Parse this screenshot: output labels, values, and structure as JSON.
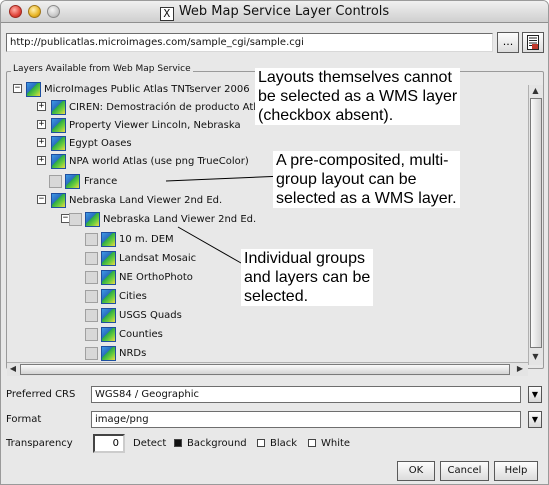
{
  "window": {
    "title": "Web Map Service Layer Controls",
    "x_logo": "X"
  },
  "url": {
    "value": "http://publicatlas.microimages.com/sample_cgi/sample.cgi",
    "browse_label": "..."
  },
  "layers": {
    "legend": "Layers Available from Web Map Service",
    "rows": [
      {
        "label": "MicroImages Public Atlas TNTserver 2006",
        "toggle": "−",
        "checkbox": false
      },
      {
        "label": "CIREN: Demostración de producto Atl",
        "toggle": "+",
        "checkbox": false
      },
      {
        "label": "Property Viewer Lincoln, Nebraska",
        "toggle": "+",
        "checkbox": false
      },
      {
        "label": "Egypt Oases",
        "toggle": "+",
        "checkbox": false
      },
      {
        "label": "NPA world Atlas (use png TrueColor)",
        "toggle": "+",
        "checkbox": false
      },
      {
        "label": "France",
        "toggle": "",
        "checkbox": true
      },
      {
        "label": "Nebraska Land Viewer 2nd Ed.",
        "toggle": "−",
        "checkbox": false
      },
      {
        "label": "Nebraska Land Viewer 2nd Ed.",
        "toggle": "−",
        "checkbox": true
      },
      {
        "label": "10 m. DEM",
        "toggle": "",
        "checkbox": true
      },
      {
        "label": "Landsat Mosaic",
        "toggle": "",
        "checkbox": true
      },
      {
        "label": "NE OrthoPhoto",
        "toggle": "",
        "checkbox": true
      },
      {
        "label": "Cities",
        "toggle": "",
        "checkbox": true
      },
      {
        "label": "USGS Quads",
        "toggle": "",
        "checkbox": true
      },
      {
        "label": "Counties",
        "toggle": "",
        "checkbox": true
      },
      {
        "label": "NRDs",
        "toggle": "",
        "checkbox": true
      }
    ]
  },
  "callouts": {
    "c1": "Layouts themselves cannot\nbe selected as a WMS layer\n(checkbox absent).",
    "c2": "A pre-composited, multi-\ngroup layout can be\nselected as a WMS layer.",
    "c3": "Individual groups\nand layers can be\nselected."
  },
  "crs": {
    "label": "Preferred CRS",
    "value": "WGS84 / Geographic"
  },
  "format": {
    "label": "Format",
    "value": "image/png"
  },
  "transparency": {
    "label": "Transparency",
    "value": "0",
    "detect_label": "Detect",
    "options": [
      {
        "label": "Background",
        "checked": true
      },
      {
        "label": "Black",
        "checked": false
      },
      {
        "label": "White",
        "checked": false
      }
    ]
  },
  "buttons": {
    "ok": "OK",
    "cancel": "Cancel",
    "help": "Help"
  },
  "icons": {
    "row_icon": "map-layer-icon",
    "doc_button": "document-icon"
  }
}
